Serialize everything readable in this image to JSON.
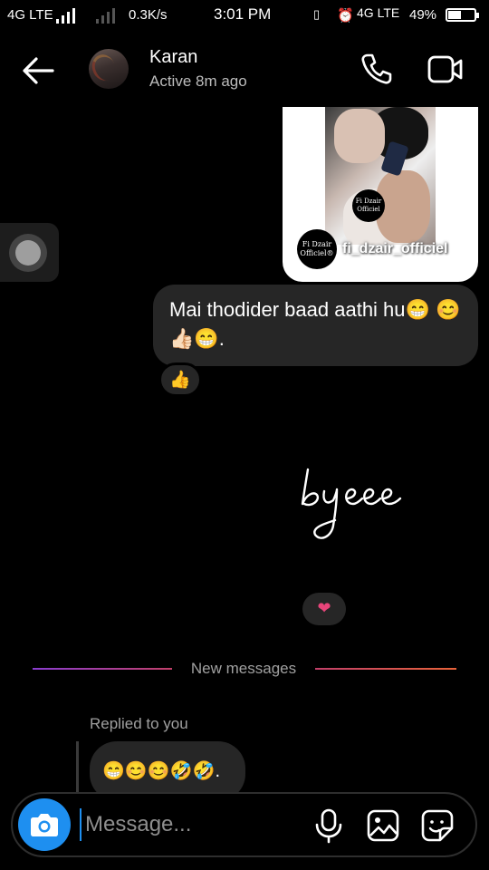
{
  "status_bar": {
    "network_left": "4G LTE",
    "speed": "0.3K/s",
    "time": "3:01 PM",
    "network_right": "4G LTE",
    "battery": "49%"
  },
  "header": {
    "contact_name": "Karan",
    "contact_status": "Active 8m ago",
    "icons": {
      "back": "arrow-left-icon",
      "call": "phone-icon",
      "video": "video-camera-icon"
    }
  },
  "shared_post": {
    "owner_username": "fi_dzair_officiel",
    "badge_text": "Fi Dzair Officiel®"
  },
  "messages": {
    "sent_text": "Mai thodider baad aathi hu😁 😊👍🏻😁.",
    "sent_reaction": "👍",
    "sticker_text": "byeee",
    "sticker_reaction": "❤",
    "divider_label": "New messages",
    "replied_label": "Replied to you",
    "reply_text": "😁😊😊🤣🤣."
  },
  "composer": {
    "placeholder": "Message...",
    "icons": [
      "camera-icon",
      "microphone-icon",
      "gallery-icon",
      "sticker-icon"
    ]
  },
  "colors": {
    "background": "#000000",
    "bubble": "#262626",
    "accent_blue": "#1e8ff0",
    "heart": "#e8457a"
  }
}
